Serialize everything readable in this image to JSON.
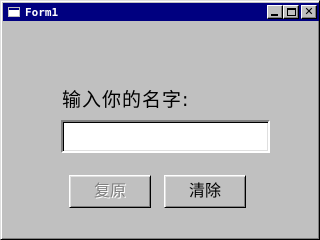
{
  "window": {
    "title": "Form1",
    "icon": "form-icon",
    "controls": {
      "minimize": "minimize-icon",
      "maximize": "maximize-icon",
      "close_glyph": "✕"
    }
  },
  "form": {
    "prompt_label": "输入你的名字:",
    "name_input": {
      "value": "",
      "placeholder": ""
    },
    "restore_button": {
      "label": "复原",
      "enabled": false
    },
    "clear_button": {
      "label": "清除",
      "enabled": true
    }
  },
  "colors": {
    "titlebar": "#000080",
    "face": "#c0c0c0",
    "disabled_text": "#808080"
  }
}
